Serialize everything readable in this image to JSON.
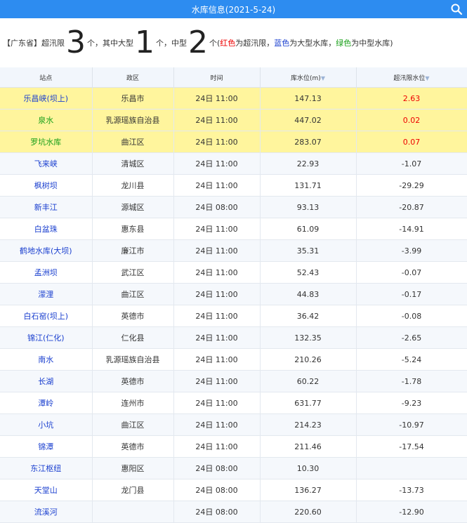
{
  "header": {
    "title": "水库信息(2021-5-24)",
    "search_icon": "search-icon"
  },
  "summary": {
    "prefix": "【广东省】超汛限",
    "total": "3",
    "after_total": "个，其中大型",
    "large": "1",
    "after_large": "个，中型",
    "medium": "2",
    "after_medium": "个(",
    "legend_red": "红色",
    "legend_red_text": "为超汛限，",
    "legend_blue": "蓝色",
    "legend_blue_text": "为大型水库，",
    "legend_green": "绿色",
    "legend_green_text": "为中型水库",
    "suffix": ")"
  },
  "columns": [
    "站点",
    "政区",
    "时间",
    "库水位(m)",
    "超汛限水位"
  ],
  "rows": [
    {
      "name": "乐昌峡(坝上)",
      "region": "乐昌市",
      "time": "24日 11:00",
      "level": "147.13",
      "over": "2.63",
      "highlight": true,
      "type": "large"
    },
    {
      "name": "泉水",
      "region": "乳源瑶族自治县",
      "time": "24日 11:00",
      "level": "447.02",
      "over": "0.02",
      "highlight": true,
      "type": "medium"
    },
    {
      "name": "罗坑水库",
      "region": "曲江区",
      "time": "24日 11:00",
      "level": "283.07",
      "over": "0.07",
      "highlight": true,
      "type": "medium"
    },
    {
      "name": "飞来峡",
      "region": "清城区",
      "time": "24日 11:00",
      "level": "22.93",
      "over": "-1.07",
      "highlight": false,
      "type": "large"
    },
    {
      "name": "枫树坝",
      "region": "龙川县",
      "time": "24日 11:00",
      "level": "131.71",
      "over": "-29.29",
      "highlight": false,
      "type": "large"
    },
    {
      "name": "新丰江",
      "region": "源城区",
      "time": "24日 08:00",
      "level": "93.13",
      "over": "-20.87",
      "highlight": false,
      "type": "large"
    },
    {
      "name": "白盆珠",
      "region": "惠东县",
      "time": "24日 11:00",
      "level": "61.09",
      "over": "-14.91",
      "highlight": false,
      "type": "large"
    },
    {
      "name": "鹤地水库(大坝)",
      "region": "廉江市",
      "time": "24日 11:00",
      "level": "35.31",
      "over": "-3.99",
      "highlight": false,
      "type": "large"
    },
    {
      "name": "孟洲坝",
      "region": "武江区",
      "time": "24日 11:00",
      "level": "52.43",
      "over": "-0.07",
      "highlight": false,
      "type": "large"
    },
    {
      "name": "濛浬",
      "region": "曲江区",
      "time": "24日 11:00",
      "level": "44.83",
      "over": "-0.17",
      "highlight": false,
      "type": "large"
    },
    {
      "name": "白石窑(坝上)",
      "region": "英德市",
      "time": "24日 11:00",
      "level": "36.42",
      "over": "-0.08",
      "highlight": false,
      "type": "large"
    },
    {
      "name": "锦江(仁化)",
      "region": "仁化县",
      "time": "24日 11:00",
      "level": "132.35",
      "over": "-2.65",
      "highlight": false,
      "type": "large"
    },
    {
      "name": "南水",
      "region": "乳源瑶族自治县",
      "time": "24日 11:00",
      "level": "210.26",
      "over": "-5.24",
      "highlight": false,
      "type": "large"
    },
    {
      "name": "长湖",
      "region": "英德市",
      "time": "24日 11:00",
      "level": "60.22",
      "over": "-1.78",
      "highlight": false,
      "type": "large"
    },
    {
      "name": "潭岭",
      "region": "连州市",
      "time": "24日 11:00",
      "level": "631.77",
      "over": "-9.23",
      "highlight": false,
      "type": "large"
    },
    {
      "name": "小坑",
      "region": "曲江区",
      "time": "24日 11:00",
      "level": "214.23",
      "over": "-10.97",
      "highlight": false,
      "type": "large"
    },
    {
      "name": "锦潭",
      "region": "英德市",
      "time": "24日 11:00",
      "level": "211.46",
      "over": "-17.54",
      "highlight": false,
      "type": "large"
    },
    {
      "name": "东江枢纽",
      "region": "惠阳区",
      "time": "24日 08:00",
      "level": "10.30",
      "over": "",
      "highlight": false,
      "type": "large"
    },
    {
      "name": "天堂山",
      "region": "龙门县",
      "time": "24日 08:00",
      "level": "136.27",
      "over": "-13.73",
      "highlight": false,
      "type": "large"
    },
    {
      "name": "流溪河",
      "region": "",
      "time": "24日 08:00",
      "level": "220.60",
      "over": "-12.90",
      "highlight": false,
      "type": "large"
    }
  ]
}
